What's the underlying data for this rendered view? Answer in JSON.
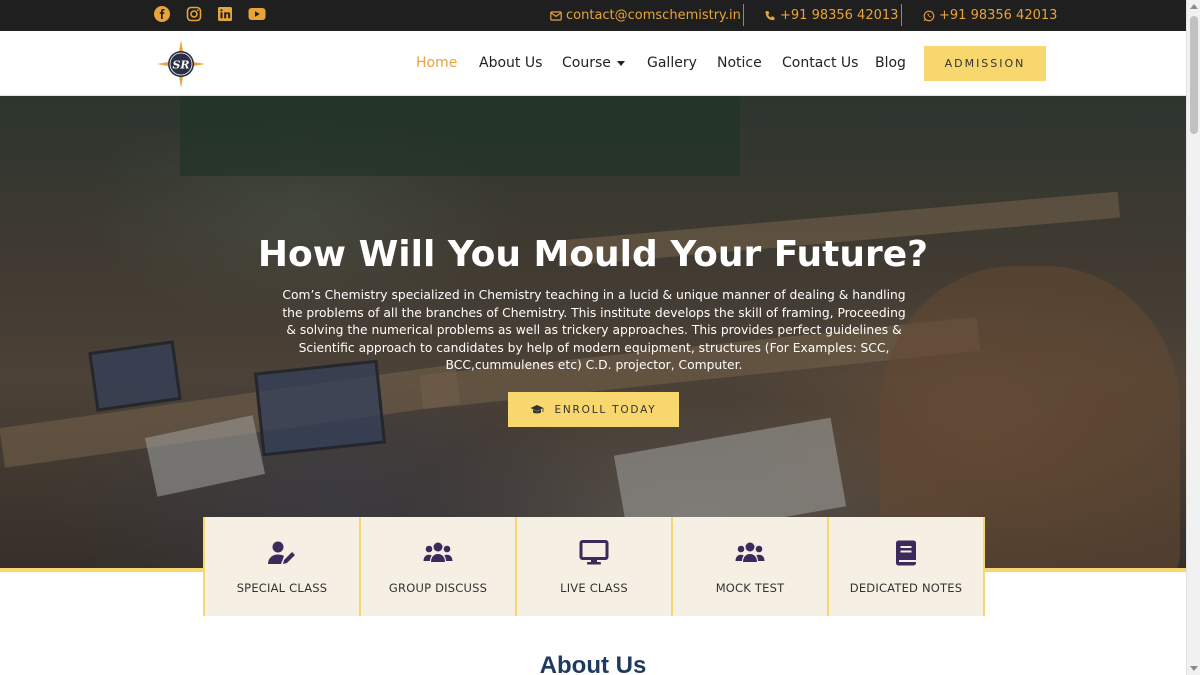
{
  "topbar": {
    "social": [
      {
        "icon": "facebook-icon"
      },
      {
        "icon": "instagram-icon"
      },
      {
        "icon": "linkedin-icon"
      },
      {
        "icon": "youtube-icon"
      }
    ],
    "email": "contact@comschemistry.in",
    "phone": "+91 98356 42013",
    "whatsapp": "+91 98356 42013",
    "accent": "#e8a33a"
  },
  "nav": {
    "logo_text": "SR",
    "items": [
      {
        "label": "Home",
        "active": true
      },
      {
        "label": "About Us"
      },
      {
        "label": "Course",
        "dropdown": true
      },
      {
        "label": "Gallery"
      },
      {
        "label": "Notice"
      },
      {
        "label": "Contact Us"
      },
      {
        "label": "Blog"
      }
    ],
    "cta": "ADMISSION"
  },
  "hero": {
    "title": "How Will You Mould Your Future?",
    "text": "Com’s Chemistry specialized in Chemistry teaching in a lucid & unique manner of dealing & handling the problems of all the branches of Chemistry. This institute develops the skill of framing, Proceeding & solving the numerical problems as well as trickery approaches. This provides perfect guidelines & Scientific approach to candidates by help of modern equipment, structures (For Examples: SCC, BCC,cummulenes etc) C.D. projector, Computer.",
    "button": "ENROLL TODAY",
    "button_icon": "graduation-cap-icon"
  },
  "features": [
    {
      "label": "SPECIAL CLASS",
      "icon": "user-edit-icon"
    },
    {
      "label": "GROUP DISCUSS",
      "icon": "users-icon"
    },
    {
      "label": "LIVE CLASS",
      "icon": "desktop-icon"
    },
    {
      "label": "MOCK TEST",
      "icon": "users-icon"
    },
    {
      "label": "DEDICATED NOTES",
      "icon": "book-icon"
    }
  ],
  "about": {
    "title": "About Us"
  },
  "colors": {
    "button_yellow": "#f7d76e",
    "icon_purple": "#3d2a5c",
    "heading_navy": "#1f3a5f"
  }
}
